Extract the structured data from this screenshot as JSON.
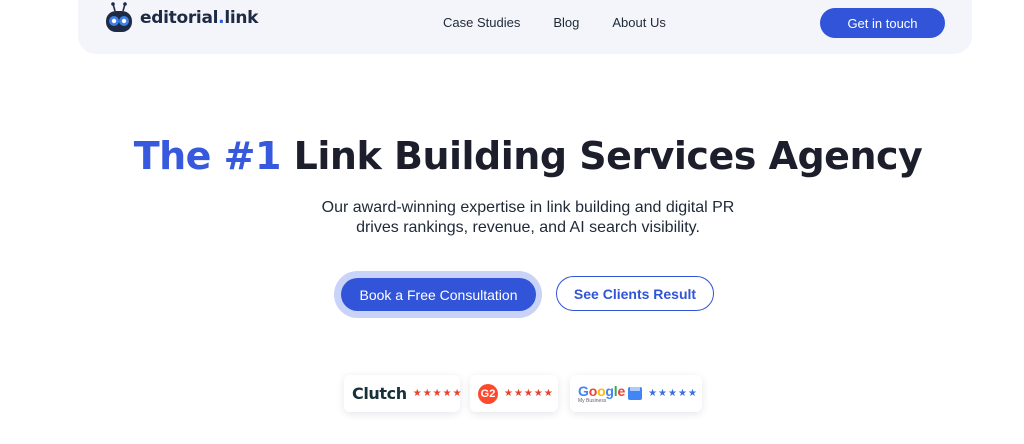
{
  "header": {
    "logo_text": "editorial",
    "logo_dot": ".",
    "logo_suffix": "link",
    "nav": [
      "Case Studies",
      "Blog",
      "About Us"
    ],
    "cta": "Get in touch"
  },
  "hero": {
    "title_accent": "The #1",
    "title_rest": " Link Building Services Agency",
    "subtitle_line1": "Our award-winning expertise in link building and digital PR",
    "subtitle_line2": "drives rankings, revenue, and AI search visibility.",
    "primary_button": "Book a Free Consultation",
    "secondary_button": "See Clients Result"
  },
  "ratings": [
    {
      "platform": "Clutch",
      "stars": "★★★★★",
      "star_color": "#e8422f"
    },
    {
      "platform": "G2",
      "stars": "★★★★★",
      "star_color": "#e8422f"
    },
    {
      "platform": "Google",
      "sub": "My Business",
      "stars": "★★★★★",
      "star_color": "#3c6fe0"
    }
  ],
  "colors": {
    "accent": "#3154d8",
    "nav_background": "#f3f5fa"
  },
  "icons": [
    "robot-mascot-icon",
    "g2-logo-icon",
    "google-my-business-icon"
  ]
}
